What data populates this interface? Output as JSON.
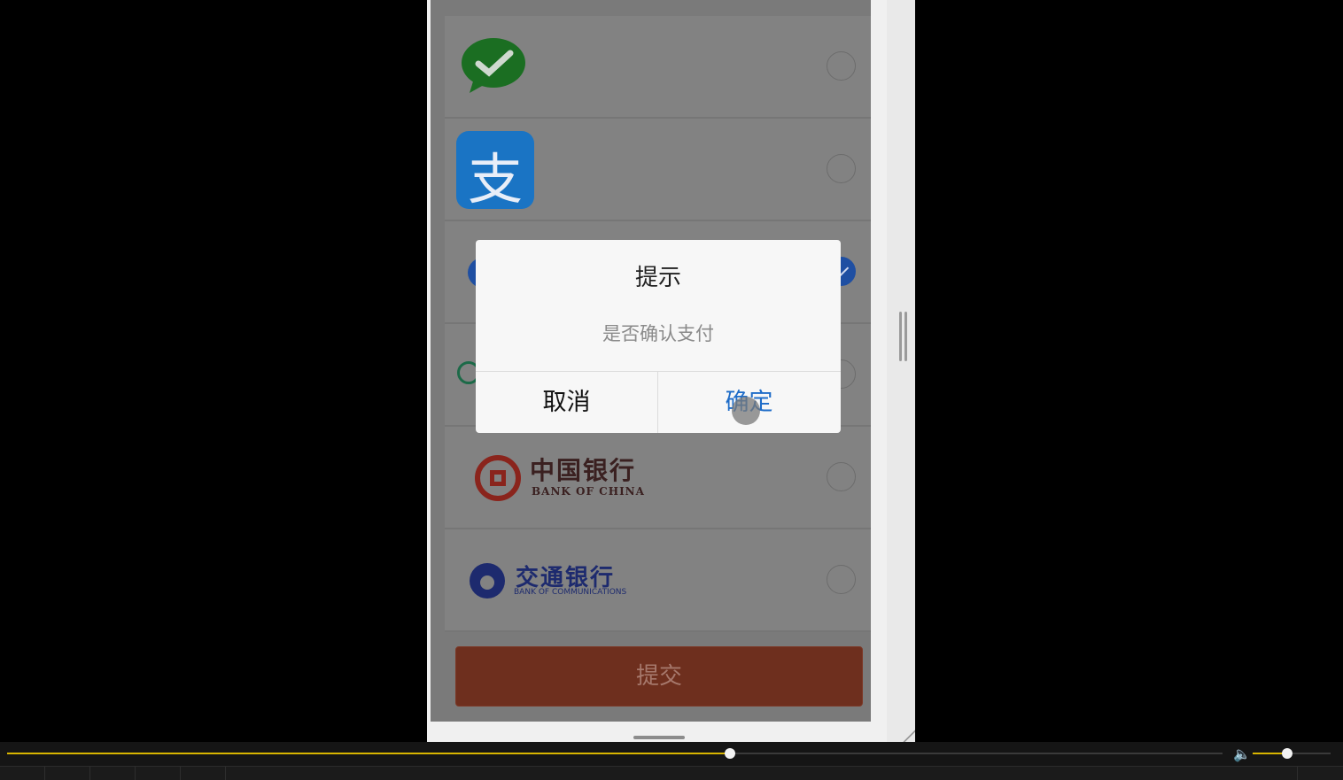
{
  "dialog": {
    "title": "提示",
    "message": "是否确认支付",
    "cancel_label": "取消",
    "confirm_label": "确定"
  },
  "payment_methods": [
    {
      "name": "wechat",
      "icon": "wechat-pay-icon",
      "selected": false
    },
    {
      "name": "alipay",
      "icon": "alipay-icon",
      "logo_text": "支",
      "selected": false
    },
    {
      "name": "ccb",
      "icon": "ccb-icon",
      "selected": true
    },
    {
      "name": "abc",
      "icon": "abc-bank-icon",
      "selected": false
    },
    {
      "name": "boc",
      "icon": "boc-icon",
      "logo_text": "中国银行",
      "logo_subtext": "BANK OF CHINA",
      "selected": false
    },
    {
      "name": "bocom",
      "icon": "bocom-icon",
      "logo_text": "交通银行",
      "logo_subtext": "BANK OF COMMUNICATIONS",
      "selected": false
    }
  ],
  "submit_label": "提交",
  "player": {
    "progress": 0.595,
    "volume": 0.44,
    "accent_color": "#d8b500",
    "volume_icon": "speaker-icon"
  },
  "colors": {
    "submit": "#6e2f1e",
    "confirm": "#1e6cc8"
  }
}
